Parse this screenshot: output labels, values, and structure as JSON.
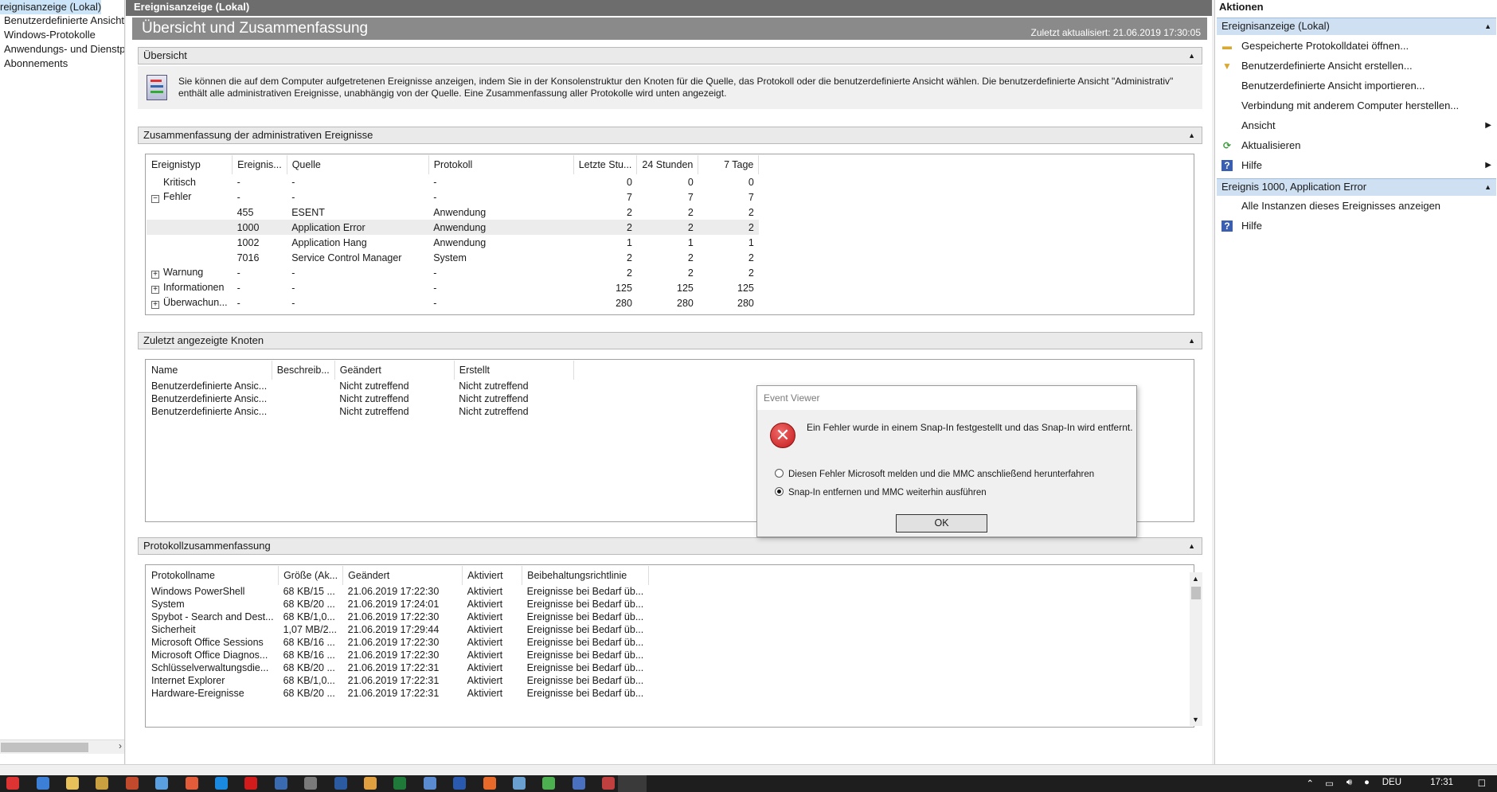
{
  "tree": {
    "items": [
      "reignisanzeige (Lokal)",
      "Benutzerdefinierte Ansichten",
      "Windows-Protokolle",
      "Anwendungs- und Dienstprotokolle",
      "Abonnements"
    ]
  },
  "center": {
    "window_title": "Ereignisanzeige (Lokal)",
    "header": "Übersicht und Zusammenfassung",
    "updated": "Zuletzt aktualisiert: 21.06.2019 17:30:05",
    "overview": {
      "title": "Übersicht",
      "text": "Sie können die auf dem Computer aufgetretenen Ereignisse anzeigen, indem Sie in der Konsolenstruktur den Knoten für die Quelle, das Protokoll oder die benutzerdefinierte Ansicht wählen. Die benutzerdefinierte Ansicht \"Administrativ\" enthält alle administrativen Ereignisse, unabhängig von der Quelle. Eine Zusammenfassung aller Protokolle wird unten angezeigt."
    },
    "admin_summary": {
      "title": "Zusammenfassung der administrativen Ereignisse",
      "columns": [
        "Ereignistyp",
        "Ereignis...",
        "Quelle",
        "Protokoll",
        "Letzte Stu...",
        "24 Stunden",
        "7 Tage"
      ],
      "rows": [
        {
          "type": "Kritisch",
          "expander": "",
          "id": "-",
          "source": "-",
          "log": "-",
          "h1": "0",
          "h24": "0",
          "d7": "0"
        },
        {
          "type": "Fehler",
          "expander": "−",
          "id": "-",
          "source": "-",
          "log": "-",
          "h1": "7",
          "h24": "7",
          "d7": "7"
        },
        {
          "type": "",
          "expander": "",
          "id": "455",
          "source": "ESENT",
          "log": "Anwendung",
          "h1": "2",
          "h24": "2",
          "d7": "2"
        },
        {
          "type": "",
          "expander": "",
          "id": "1000",
          "source": "Application Error",
          "log": "Anwendung",
          "h1": "2",
          "h24": "2",
          "d7": "2"
        },
        {
          "type": "",
          "expander": "",
          "id": "1002",
          "source": "Application Hang",
          "log": "Anwendung",
          "h1": "1",
          "h24": "1",
          "d7": "1"
        },
        {
          "type": "",
          "expander": "",
          "id": "7016",
          "source": "Service Control Manager",
          "log": "System",
          "h1": "2",
          "h24": "2",
          "d7": "2"
        },
        {
          "type": "Warnung",
          "expander": "+",
          "id": "-",
          "source": "-",
          "log": "-",
          "h1": "2",
          "h24": "2",
          "d7": "2"
        },
        {
          "type": "Informationen",
          "expander": "+",
          "id": "-",
          "source": "-",
          "log": "-",
          "h1": "125",
          "h24": "125",
          "d7": "125"
        },
        {
          "type": "Überwachun...",
          "expander": "+",
          "id": "-",
          "source": "-",
          "log": "-",
          "h1": "280",
          "h24": "280",
          "d7": "280"
        }
      ]
    },
    "recent_nodes": {
      "title": "Zuletzt angezeigte Knoten",
      "columns": [
        "Name",
        "Beschreib...",
        "Geändert",
        "Erstellt"
      ],
      "rows": [
        [
          "Benutzerdefinierte Ansic...",
          "",
          "Nicht zutreffend",
          "Nicht zutreffend"
        ],
        [
          "Benutzerdefinierte Ansic...",
          "",
          "Nicht zutreffend",
          "Nicht zutreffend"
        ],
        [
          "Benutzerdefinierte Ansic...",
          "",
          "Nicht zutreffend",
          "Nicht zutreffend"
        ]
      ]
    },
    "log_summary": {
      "title": "Protokollzusammenfassung",
      "columns": [
        "Protokollname",
        "Größe (Ak...",
        "Geändert",
        "Aktiviert",
        "Beibehaltungsrichtlinie"
      ],
      "rows": [
        [
          "Windows PowerShell",
          "68 KB/15 ...",
          "21.06.2019 17:22:30",
          "Aktiviert",
          "Ereignisse bei Bedarf üb..."
        ],
        [
          "System",
          "68 KB/20 ...",
          "21.06.2019 17:24:01",
          "Aktiviert",
          "Ereignisse bei Bedarf üb..."
        ],
        [
          "Spybot - Search and Dest...",
          "68 KB/1,0...",
          "21.06.2019 17:22:30",
          "Aktiviert",
          "Ereignisse bei Bedarf üb..."
        ],
        [
          "Sicherheit",
          "1,07 MB/2...",
          "21.06.2019 17:29:44",
          "Aktiviert",
          "Ereignisse bei Bedarf üb..."
        ],
        [
          "Microsoft Office Sessions",
          "68 KB/16 ...",
          "21.06.2019 17:22:30",
          "Aktiviert",
          "Ereignisse bei Bedarf üb..."
        ],
        [
          "Microsoft Office Diagnos...",
          "68 KB/16 ...",
          "21.06.2019 17:22:30",
          "Aktiviert",
          "Ereignisse bei Bedarf üb..."
        ],
        [
          "Schlüsselverwaltungsdie...",
          "68 KB/20 ...",
          "21.06.2019 17:22:31",
          "Aktiviert",
          "Ereignisse bei Bedarf üb..."
        ],
        [
          "Internet Explorer",
          "68 KB/1,0...",
          "21.06.2019 17:22:31",
          "Aktiviert",
          "Ereignisse bei Bedarf üb..."
        ],
        [
          "Hardware-Ereignisse",
          "68 KB/20 ...",
          "21.06.2019 17:22:31",
          "Aktiviert",
          "Ereignisse bei Bedarf üb..."
        ]
      ]
    }
  },
  "actions": {
    "title": "Aktionen",
    "group1": "Ereignisanzeige (Lokal)",
    "items1": [
      {
        "label": "Gespeicherte Protokolldatei öffnen...",
        "icon": "folder-icon"
      },
      {
        "label": "Benutzerdefinierte Ansicht erstellen...",
        "icon": "filter-icon"
      },
      {
        "label": "Benutzerdefinierte Ansicht importieren...",
        "icon": ""
      },
      {
        "label": "Verbindung mit anderem Computer herstellen...",
        "icon": ""
      },
      {
        "label": "Ansicht",
        "icon": ""
      },
      {
        "label": "Aktualisieren",
        "icon": "refresh-icon"
      },
      {
        "label": "Hilfe",
        "icon": "help-icon"
      }
    ],
    "group2": "Ereignis 1000, Application Error",
    "items2": [
      {
        "label": "Alle Instanzen dieses Ereignisses anzeigen",
        "icon": ""
      },
      {
        "label": "Hilfe",
        "icon": "help-icon"
      }
    ]
  },
  "dialog": {
    "title": "Event Viewer",
    "message": "Ein Fehler wurde in einem Snap-In festgestellt und das Snap-In wird entfernt.",
    "option1": "Diesen Fehler Microsoft melden und die MMC anschließend herunterfahren",
    "option2": "Snap-In entfernen und MMC weiterhin ausführen",
    "selected_option": 2,
    "ok": "OK"
  },
  "taskbar": {
    "lang": "DEU",
    "time": "17:31"
  },
  "colors": {
    "header_band": "#8a8a8a",
    "window_title": "#6d6d6d",
    "action_group": "#cfe0f2",
    "taskbar": "#1e1e1e",
    "error": "#c41818"
  }
}
